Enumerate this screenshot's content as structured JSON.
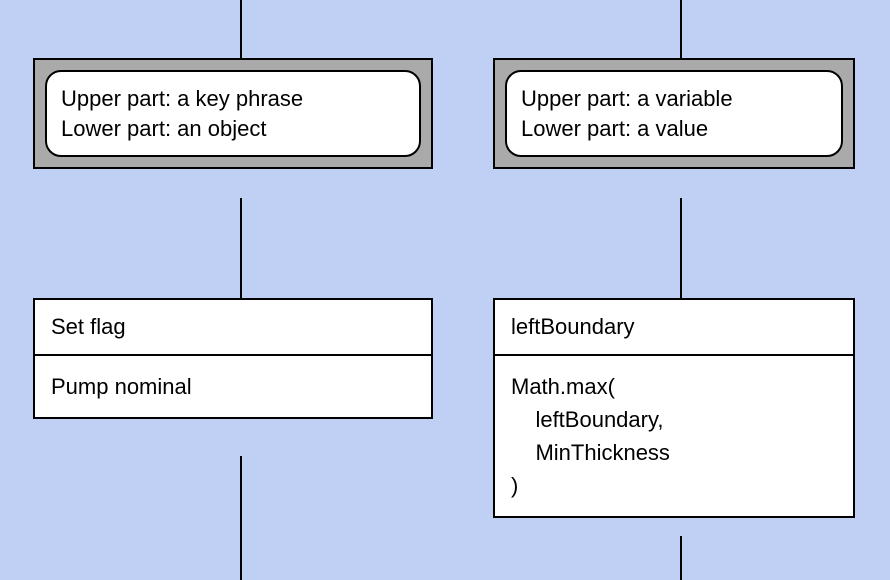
{
  "left": {
    "definition": {
      "line1": "Upper part: a key phrase",
      "line2": "Lower part: an object"
    },
    "example": {
      "upper": "Set flag",
      "lower": "Pump nominal"
    }
  },
  "right": {
    "definition": {
      "line1": "Upper part: a variable",
      "line2": "Lower part: a value"
    },
    "example": {
      "upper": "leftBoundary",
      "lower": "Math.max(\n    leftBoundary,\n    MinThickness\n)"
    }
  }
}
